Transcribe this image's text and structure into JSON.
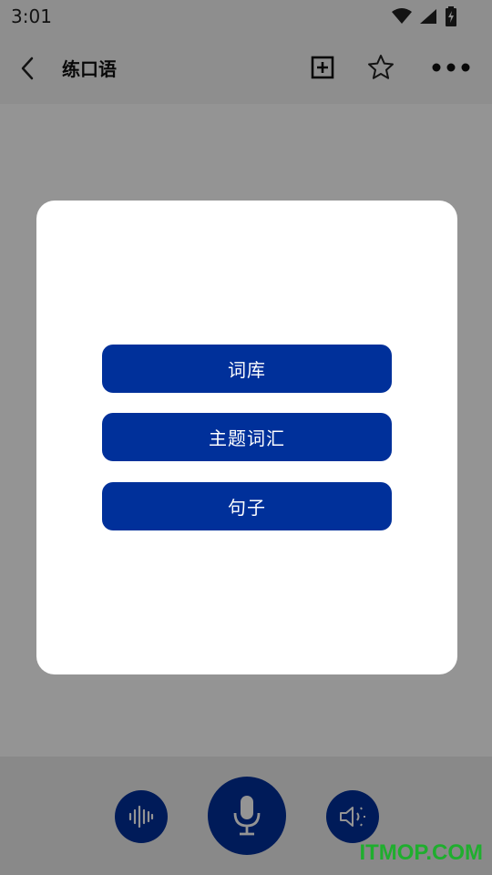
{
  "status_bar": {
    "time": "3:01",
    "icons": [
      "wifi-icon",
      "cell-signal-icon",
      "battery-charging-icon"
    ]
  },
  "toolbar": {
    "title": "练口语",
    "icons": [
      "back-arrow-icon",
      "add-square-icon",
      "star-icon",
      "more-dots-icon"
    ]
  },
  "dialog": {
    "options": [
      "词库",
      "主题词汇",
      "句子"
    ]
  },
  "bottom_bar": {
    "icons": [
      "waveform-icon",
      "microphone-icon",
      "speaker-icon"
    ]
  },
  "watermark": "ITMOP.COM",
  "colors": {
    "accent": "#00309a",
    "watermark": "#1fae2e"
  }
}
